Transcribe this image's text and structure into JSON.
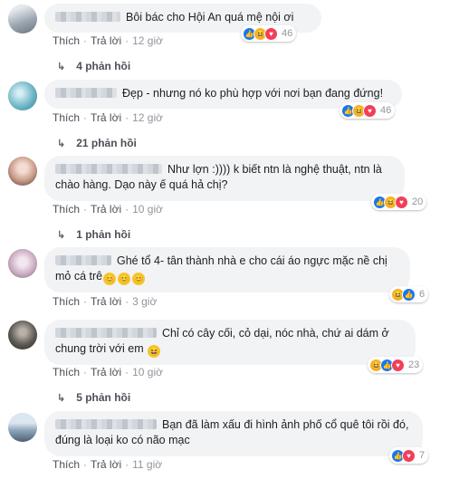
{
  "actions": {
    "like": "Thích",
    "reply": "Trả lời"
  },
  "comments": [
    {
      "text": "Bôi bác cho Hội An quá mệ nội ơi",
      "reaction_count": "46",
      "time": "12 giờ",
      "replies": "4 phản hồi",
      "reactions": [
        "like-icon",
        "haha-icon",
        "love-icon"
      ],
      "avatar_color": "#a9b3bd"
    },
    {
      "text": "Đẹp - nhưng nó ko phù hợp với nơi bạn đang đứng!",
      "reaction_count": "46",
      "time": "12 giờ",
      "replies": "21 phản hồi",
      "reactions": [
        "like-icon",
        "haha-icon",
        "love-icon"
      ],
      "avatar_color": "#6fb7c7"
    },
    {
      "text": "Như lợn :)))) k biết ntn là nghệ thuật, ntn là chào hàng. Dạo này ế quá hả chị?",
      "reaction_count": "20",
      "time": "10 giờ",
      "replies": "1 phản hồi",
      "reactions": [
        "like-icon",
        "haha-icon",
        "love-icon"
      ],
      "avatar_color": "#d9b7a8"
    },
    {
      "text": "Ghé tổ 4- tân thành nhà e cho cái áo ngực mặc nề chị mỏ cá trê",
      "emoji_suffix": [
        "😊",
        "😊",
        "😊"
      ],
      "reaction_count": "6",
      "time": "3 giờ",
      "replies": "",
      "reactions": [
        "haha-icon",
        "like-icon"
      ],
      "avatar_color": "#d6c3d1"
    },
    {
      "text": "Chỉ có cây cối, cỏ dại, nóc nhà, chứ ai dám ở chung trời với em",
      "emoji_suffix": [
        "😆"
      ],
      "reaction_count": "23",
      "time": "10 giờ",
      "replies": "5 phản hồi",
      "reactions": [
        "haha-icon",
        "like-icon",
        "love-icon"
      ],
      "avatar_color": "#5d5a55"
    },
    {
      "text": "Bạn đã làm xấu đi hình ảnh phố cổ quê tôi rồi đó, đúng là loại ko có não mạc",
      "reaction_count": "7",
      "time": "11 giờ",
      "replies": "",
      "reactions": [
        "like-icon",
        "love-icon"
      ],
      "avatar_color": "#b8c4d0"
    }
  ]
}
